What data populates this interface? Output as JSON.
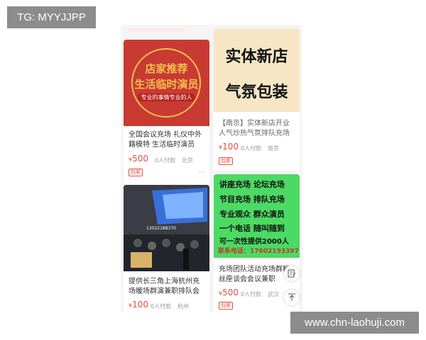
{
  "watermarks": {
    "top_left": "TG: MYYJJPP",
    "bottom_right": "www.chn-laohuji.com"
  },
  "cards": [
    {
      "image_text": {
        "line1": "店家推荐",
        "line2": "生活临时演员",
        "line3": "专业的事情专业的人"
      },
      "title": "全国会议充场 礼仪中外籍模特 生活临时演员",
      "currency": "¥",
      "price": "500",
      "payers": "0人付款",
      "location": "北京",
      "tag": "包邮"
    },
    {
      "image_text": {
        "line1": "实体新店",
        "line2": "气氛包装"
      },
      "title": "【南京】实体新店开业人气炒热气氛排队充场",
      "currency": "¥",
      "price": "100",
      "payers": "0人付款",
      "location": "南京",
      "tag": "包邮"
    },
    {
      "image_text": {
        "label": "13022188370"
      },
      "title": "提供长三角上海杭州充场暖场群演兼职排队会",
      "currency": "¥",
      "price": "100",
      "payers": "0人付款",
      "location": "杭州",
      "tag": ""
    },
    {
      "image_text": {
        "lines": [
          "讲座充场  论坛充场",
          "节目充场  排队充场",
          "专业观众  群众演员",
          "一个电话  随叫随到",
          "可一次性提供2000人"
        ],
        "contact": "联系电话：17602193397"
      },
      "title": "充场团队活动充场群粉丝座谈会会议兼职",
      "currency": "¥",
      "price": "500",
      "payers": "0人付款",
      "location": "武汉",
      "tag": "包邮"
    }
  ],
  "icons": {
    "more": "…",
    "edit": "edit-icon",
    "top": "arrow-up-icon"
  },
  "colors": {
    "price": "#e94c3c",
    "card1_bg": "#c83a32",
    "card2_bg": "#f6e6c6",
    "card4_bg": "#4cd964"
  }
}
